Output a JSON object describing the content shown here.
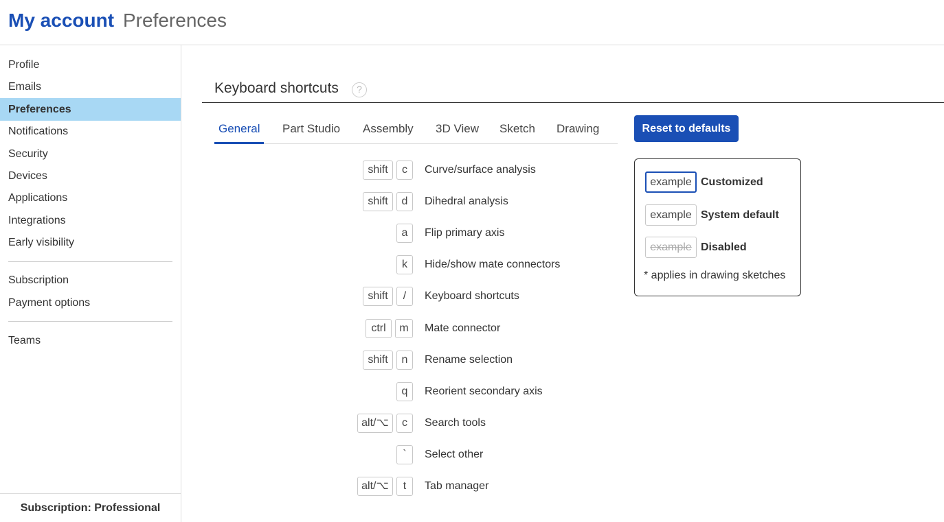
{
  "header": {
    "title": "My account",
    "subtitle": "Preferences"
  },
  "sidebar": {
    "items": [
      {
        "label": "Profile"
      },
      {
        "label": "Emails"
      },
      {
        "label": "Preferences",
        "active": true
      },
      {
        "label": "Notifications"
      },
      {
        "label": "Security"
      },
      {
        "label": "Devices"
      },
      {
        "label": "Applications"
      },
      {
        "label": "Integrations"
      },
      {
        "label": "Early visibility"
      },
      {
        "label": "Subscription"
      },
      {
        "label": "Payment options"
      },
      {
        "label": "Teams"
      }
    ],
    "footer": "Subscription: Professional"
  },
  "section": {
    "title": "Keyboard shortcuts",
    "help_icon": "?"
  },
  "tabs": [
    "General",
    "Part Studio",
    "Assembly",
    "3D View",
    "Sketch",
    "Drawing"
  ],
  "active_tab": "General",
  "reset_button": "Reset to defaults",
  "shortcuts": [
    {
      "keys": [
        "shift",
        "c"
      ],
      "label": "Curve/surface analysis"
    },
    {
      "keys": [
        "shift",
        "d"
      ],
      "label": "Dihedral analysis"
    },
    {
      "keys": [
        "a"
      ],
      "label": "Flip primary axis"
    },
    {
      "keys": [
        "k"
      ],
      "label": "Hide/show mate connectors"
    },
    {
      "keys": [
        "shift",
        "/"
      ],
      "label": "Keyboard shortcuts"
    },
    {
      "keys": [
        "ctrl",
        "m"
      ],
      "label": "Mate connector"
    },
    {
      "keys": [
        "shift",
        "n"
      ],
      "label": "Rename selection"
    },
    {
      "keys": [
        "q"
      ],
      "label": "Reorient secondary axis"
    },
    {
      "keys": [
        "alt/⌥",
        "c"
      ],
      "label": "Search tools"
    },
    {
      "keys": [
        "`"
      ],
      "label": "Select other"
    },
    {
      "keys": [
        "alt/⌥",
        "t"
      ],
      "label": "Tab manager"
    }
  ],
  "legend": {
    "rows": [
      {
        "key": "example",
        "label": "Customized"
      },
      {
        "key": "example",
        "label": "System default"
      },
      {
        "key": "example",
        "label": "Disabled"
      }
    ],
    "note": "* applies in drawing sketches"
  },
  "colors": {
    "accent": "#1a4fb5",
    "active_nav_bg": "#a8d8f4"
  }
}
